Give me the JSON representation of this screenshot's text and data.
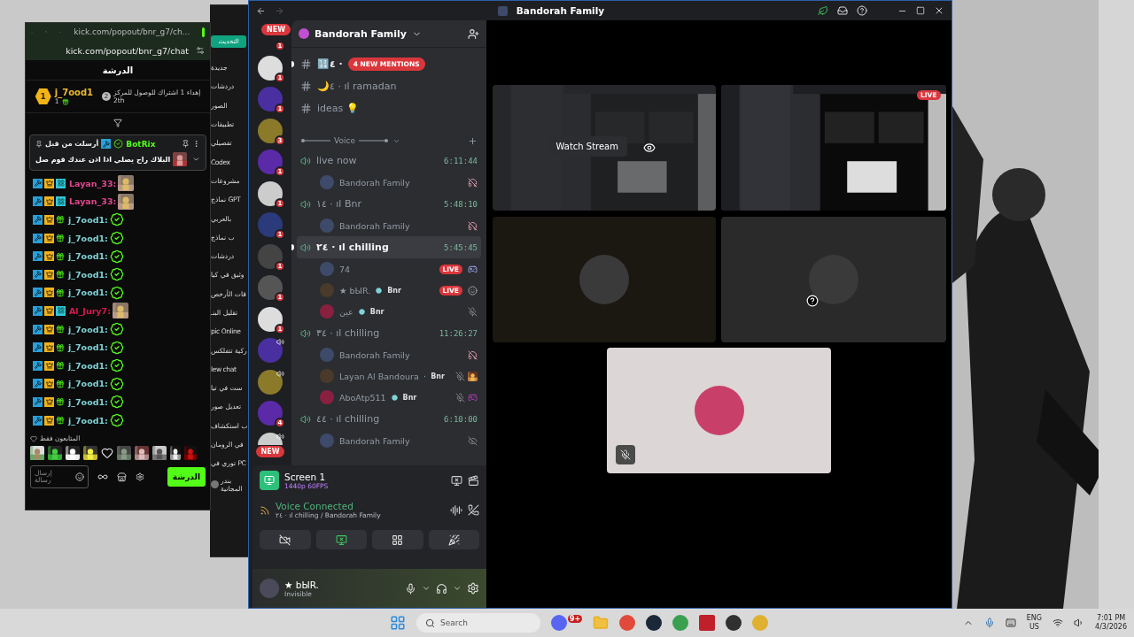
{
  "kick_window": {
    "tab_title": "kick.com/popout/bnr_g7/ch...",
    "url": "kick.com/popout/bnr_g7/chat",
    "title": "الدرشة",
    "leaders": [
      {
        "rank": "1",
        "name": "j_7ood1",
        "count": "1"
      }
    ],
    "next_goal": {
      "rank": "2",
      "text": "إهداء 1 اشتراك للوصول للمركز",
      "place": "2th"
    },
    "pinned": {
      "meta": "أرسلت من قبل",
      "author": "BotRix",
      "message": "البلاك راح يصلي اذا اذن عندك قوم صل"
    },
    "messages": [
      {
        "user": "Layan_33:",
        "color": "#e0468c",
        "kind": "subscriber"
      },
      {
        "user": "Layan_33:",
        "color": "#e0468c",
        "kind": "subscriber"
      },
      {
        "user": "j_7ood1:",
        "color": "#7fd3d6",
        "kind": "gifter"
      },
      {
        "user": "j_7ood1:",
        "color": "#7fd3d6",
        "kind": "gifter"
      },
      {
        "user": "j_7ood1:",
        "color": "#7fd3d6",
        "kind": "gifter"
      },
      {
        "user": "j_7ood1:",
        "color": "#7fd3d6",
        "kind": "gifter"
      },
      {
        "user": "j_7ood1:",
        "color": "#7fd3d6",
        "kind": "gifter"
      },
      {
        "user": "Al_Jury7:",
        "color": "#d4194c",
        "kind": "subscriber"
      },
      {
        "user": "j_7ood1:",
        "color": "#7fd3d6",
        "kind": "gifter"
      },
      {
        "user": "j_7ood1:",
        "color": "#7fd3d6",
        "kind": "gifter"
      },
      {
        "user": "j_7ood1:",
        "color": "#7fd3d6",
        "kind": "gifter"
      },
      {
        "user": "j_7ood1:",
        "color": "#7fd3d6",
        "kind": "gifter"
      },
      {
        "user": "j_7ood1:",
        "color": "#7fd3d6",
        "kind": "gifter"
      },
      {
        "user": "j_7ood1:",
        "color": "#7fd3d6",
        "kind": "gifter"
      }
    ],
    "followers_label": "المتابعون فقط",
    "input_placeholder": "إرسال رسالة",
    "chat_button": "الدرشة"
  },
  "back_window": {
    "update_button": "التحديث",
    "items": [
      "جديدة",
      "دردشات",
      "الصور",
      "تطبيقات",
      "تفصيلي",
      "Codex",
      "مشروعات",
      "نماذج GPT",
      "بالعربي",
      "ب نماذج",
      "دردشات",
      "وثيق في كيا",
      "قات الأرخص",
      "تقليل البنـ",
      "pic Online",
      "ركية تتفلكس",
      "lew chat",
      "ست في تيا",
      "تعديل صور",
      "ب استكشاف",
      "في الرومان",
      "توري في PC"
    ],
    "user_name": "بندر",
    "plan": "المجانية"
  },
  "discord": {
    "title": "Bandorah Family",
    "new_pills": [
      "NEW",
      "NEW"
    ],
    "servers": [
      {
        "badge": "1",
        "audio": false
      },
      {
        "badge": "1",
        "audio": false
      },
      {
        "badge": "1",
        "audio": false
      },
      {
        "badge": "3",
        "audio": false
      },
      {
        "badge": "1",
        "audio": false
      },
      {
        "badge": "1",
        "audio": false
      },
      {
        "badge": "1",
        "audio": false
      },
      {
        "badge": "1",
        "audio": false
      },
      {
        "badge": "1",
        "audio": false
      },
      {
        "badge": "1",
        "audio": false
      },
      {
        "audio": true
      },
      {
        "audio": true
      },
      {
        "badge": "4",
        "audio": false
      },
      {
        "audio": true
      }
    ],
    "server_name": "Bandorah Family",
    "text_channels": [
      {
        "name": "🔢٤ ·",
        "mention": "4 NEW MENTIONS",
        "unread": true
      },
      {
        "name": "🌙٤ · ıl ramadan",
        "unread": false
      },
      {
        "name": "ideas 💡",
        "unread": false
      }
    ],
    "voice_category": "Voice",
    "voice_channels": [
      {
        "name": "live now",
        "timer": "6:11:44",
        "selected": false,
        "unread": false,
        "members": [
          {
            "name": "Bandorah Family",
            "kind": "deafened"
          }
        ]
      },
      {
        "name": "١٤ · ıl Bnr",
        "timer": "5:48:10",
        "selected": false,
        "unread": false,
        "members": [
          {
            "name": "Bandorah Family",
            "kind": "deafened"
          }
        ]
      },
      {
        "name": "٢٤ · ıl chilling",
        "timer": "5:45:45",
        "selected": true,
        "unread": true,
        "members": [
          {
            "name": "74",
            "badge": "LIVE",
            "kind": "game"
          },
          {
            "name": "★ bЫR.",
            "tag": "Bnr",
            "badge": "LIVE",
            "kind": "emoji"
          },
          {
            "name": "عين",
            "tag": "Bnr",
            "kind": "muted"
          }
        ]
      },
      {
        "name": "٣٤ · ıl chilling",
        "timer": "11:26:27",
        "selected": false,
        "unread": false,
        "members": [
          {
            "name": "Bandorah Family",
            "kind": "deafened"
          },
          {
            "name": "Layan Al Bandoura",
            "tag": "Bnr",
            "kind": "muted_image"
          },
          {
            "name": "AboAtp511",
            "tag": "Bnr",
            "kind": "muted_game"
          }
        ]
      },
      {
        "name": "٤٤ · ıl chilling",
        "timer": "6:10:00",
        "selected": false,
        "unread": false,
        "members": [
          {
            "name": "Bandorah Family",
            "kind": "hidden"
          }
        ]
      }
    ],
    "screen_share": {
      "title": "Screen 1",
      "quality": "1440p 60FPS"
    },
    "voice_status": {
      "title": "Voice Connected",
      "channel": "٢٤ · ıl chilling / Bandorah Family"
    },
    "user": {
      "name": "★ bЫR.",
      "status": "Invisible"
    },
    "tiles": [
      {
        "kind": "stream",
        "button": "Watch Stream"
      },
      {
        "kind": "stream",
        "badge": "LIVE"
      },
      {
        "kind": "avatar",
        "muted": false,
        "unknown": false
      },
      {
        "kind": "avatar",
        "muted": false,
        "unknown": true
      },
      {
        "kind": "avatar",
        "muted": true,
        "unknown": false
      }
    ]
  },
  "taskbar": {
    "search_placeholder": "Search",
    "discord_badge": "9+",
    "language": "ENG",
    "region": "US",
    "time": "7:01 PM",
    "date": "4/3/2026"
  }
}
